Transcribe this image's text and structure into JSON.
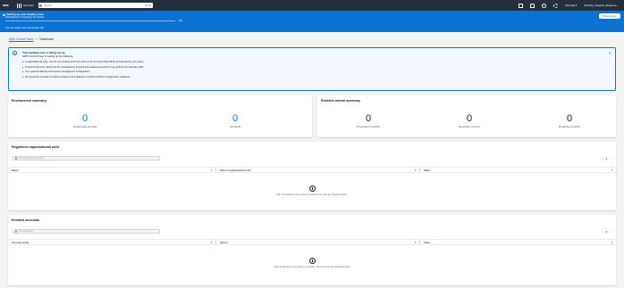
{
  "topnav": {
    "logo": "aws",
    "services_label": "Services",
    "search_placeholder": "Search",
    "search_shortcut": "[Alt+S]",
    "region": "Mumbai ▾",
    "account": "StartUp_Integrati_Engineer..."
  },
  "flash": {
    "title": "Setting up your landing zone",
    "subtitle": "Estimated time remaining: 60 minutes",
    "progress_pct": 0,
    "progress_label": "0%",
    "note": "You can safely close this browser tab.",
    "button": "Show steps"
  },
  "breadcrumb": {
    "root": "AWS Control Tower",
    "sep": ">",
    "current": "Dashboard"
  },
  "info": {
    "title": "Your landing zone is being set up",
    "subtitle": "AWS Control Tower is setting up the following:",
    "items": [
      "2 organizational units, one for your shared accounts and one for accounts that will be provisioned by your users.",
      "2 shared accounts, which are the management account and isolated accounts for log archive and security audit.",
      "Your selected identity and access management configuration.",
      "20 preventive controls to enforce policies and 3 detective controls to detect configuration violations."
    ]
  },
  "environment": {
    "title": "Environment summary",
    "stats": [
      {
        "value": "0",
        "label": "Organizational units"
      },
      {
        "value": "0",
        "label": "Accounts"
      }
    ]
  },
  "controls": {
    "title": "Enabled control summary",
    "stats": [
      {
        "value": "0",
        "label": "Preventive controls"
      },
      {
        "value": "0",
        "label": "Detective controls"
      },
      {
        "value": "0",
        "label": "Proactive controls"
      }
    ]
  },
  "ou_table": {
    "title": "Registered organizational units",
    "search_placeholder": "Find organizational units",
    "page": "1",
    "columns": [
      "Name",
      "Parent organizational unit",
      "State"
    ],
    "empty_text": "After the landing zone setup is complete, the OUs are displayed here."
  },
  "accounts_table": {
    "title": "Enrolled accounts",
    "search_placeholder": "Find accounts",
    "page": "1",
    "columns": [
      "Account email",
      "Owner",
      "State"
    ],
    "empty_text": "After the landing zone setup is complete, the accounts are displayed here."
  },
  "colors": {
    "nav_bg": "#232f3e",
    "flash_bg": "#0972d3",
    "accent": "#0972d3",
    "page_bg": "#f2f3f3"
  }
}
